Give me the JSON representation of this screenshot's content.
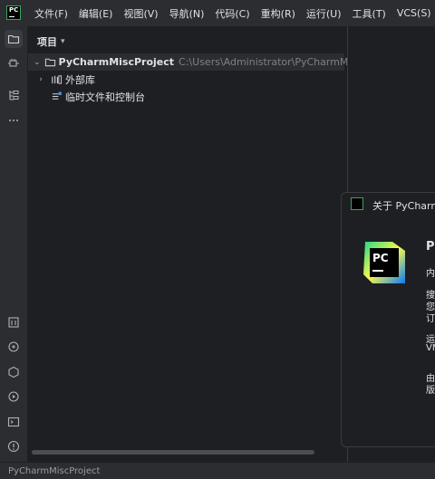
{
  "menu": {
    "logo_text": "PC",
    "items": [
      "文件(F)",
      "编辑(E)",
      "视图(V)",
      "导航(N)",
      "代码(C)",
      "重构(R)",
      "运行(U)",
      "工具(T)",
      "VCS(S)"
    ],
    "overflow_icon": "overflow-icon"
  },
  "toolstrip": {
    "top_tools": [
      "folder-icon",
      "plugin-icon",
      "structure-icon",
      "more-icon"
    ],
    "bottom_tools": [
      "python-packages-icon",
      "python-console-icon",
      "services-icon",
      "run-icon",
      "terminal-icon",
      "problems-icon"
    ]
  },
  "project_panel": {
    "title": "项目",
    "root_name": "PyCharmMiscProject",
    "root_path": "C:\\Users\\Administrator\\PyCharmMiscPr",
    "external_libs": "外部库",
    "scratches": "临时文件和控制台"
  },
  "about_dialog": {
    "title": "关于 PyCharm",
    "logo_text": "PC",
    "product_name": "Py",
    "lines": [
      "内",
      "搜",
      "您",
      "订",
      "运",
      "VM",
      "由",
      "版"
    ]
  },
  "status": {
    "project_name": "PyCharmMiscProject"
  },
  "colors": {
    "background": "#1e1f22",
    "panel": "#2b2d30",
    "accent_green": "#3ba55d"
  }
}
